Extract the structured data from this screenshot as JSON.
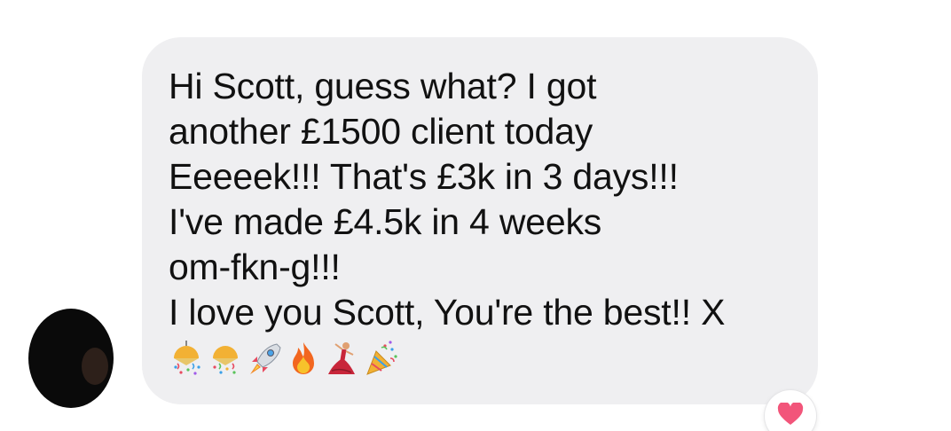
{
  "message": {
    "lines": [
      "Hi Scott, guess what? I got",
      "another £1500 client today",
      "Eeeeek!!! That's £3k in 3 days!!!",
      "I've made £4.5k in 4 weeks",
      "om-fkn-g!!!",
      "I love you Scott, You're the best!! X"
    ],
    "emojis": [
      "confetti-ball",
      "confetti-ball",
      "rocket",
      "fire",
      "dancer",
      "party-popper"
    ]
  },
  "reaction": {
    "emoji": "heart"
  },
  "colors": {
    "bubble": "#efeff1",
    "text": "#111111",
    "reaction_heart": "#f2557a"
  }
}
